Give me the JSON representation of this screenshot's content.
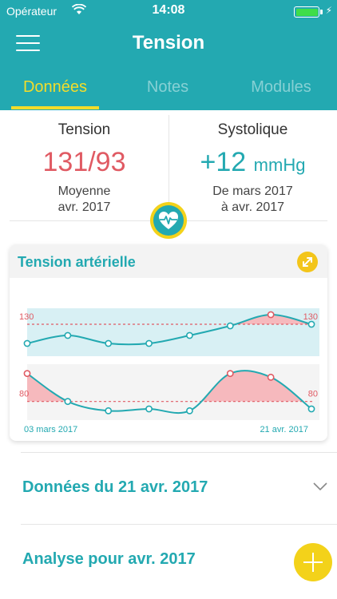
{
  "statusbar": {
    "carrier": "Opérateur",
    "time": "14:08"
  },
  "header": {
    "title": "Tension"
  },
  "tabs": [
    {
      "label": "Données",
      "active": true
    },
    {
      "label": "Notes",
      "active": false
    },
    {
      "label": "Modules",
      "active": false
    }
  ],
  "stats": {
    "left": {
      "label": "Tension",
      "value": "131/93",
      "sub1": "Moyenne",
      "sub2": "avr. 2017"
    },
    "right": {
      "label": "Systolique",
      "value": "+12",
      "unit": "mmHg",
      "sub1": "De mars 2017",
      "sub2": "à avr. 2017"
    }
  },
  "card": {
    "title": "Tension artérielle",
    "start_date": "03 mars 2017",
    "end_date": "21 avr. 2017"
  },
  "chart_data": {
    "type": "line",
    "title": "Tension artérielle",
    "x": [
      "03 mars 2017",
      "",
      "",
      "",
      "",
      "",
      "",
      "21 avr. 2017"
    ],
    "series": [
      {
        "values": [
          118,
          123,
          118,
          118,
          123,
          129,
          136,
          130
        ]
      },
      {
        "values": [
          95,
          80,
          75,
          76,
          75,
          95,
          93,
          76
        ]
      }
    ],
    "thresholds": {
      "upper": 130,
      "lower": 80
    },
    "threshold_labels": [
      "130",
      "80"
    ],
    "colors": {
      "line": "#23a9b1",
      "above": "#f6b9bd",
      "threshold": "#e05a63",
      "band": "#d8f0f4"
    }
  },
  "rows": [
    {
      "label": "Données du 21 avr. 2017"
    },
    {
      "label": "Analyse pour avr. 2017"
    }
  ],
  "colors": {
    "accent": "#23a9b1",
    "alert": "#e05a63",
    "highlight": "#f3dd2a"
  }
}
